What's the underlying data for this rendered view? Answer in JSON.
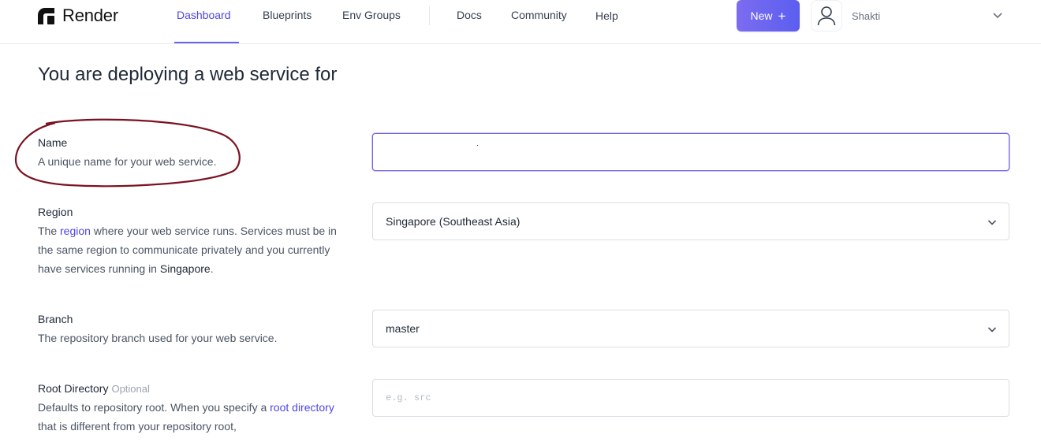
{
  "brand": {
    "name": "Render"
  },
  "nav": {
    "items": [
      {
        "label": "Dashboard",
        "active": true
      },
      {
        "label": "Blueprints"
      },
      {
        "label": "Env Groups"
      },
      {
        "label": "Docs"
      },
      {
        "label": "Community"
      },
      {
        "label": "Help"
      }
    ]
  },
  "header": {
    "new_button": {
      "label": "New",
      "icon": "plus-icon"
    },
    "user": {
      "name": "Shakti",
      "icon": "user-icon"
    }
  },
  "page": {
    "title": "You are deploying a web service for"
  },
  "form": {
    "name": {
      "label": "Name",
      "description": "A unique name for your web service.",
      "value": ""
    },
    "region": {
      "label": "Region",
      "desc_before": "The ",
      "desc_link": "region",
      "desc_after": " where your web service runs. Services must be in the same region to communicate privately and you currently have services running in ",
      "desc_strong": "Singapore",
      "desc_end": ".",
      "value": "Singapore (Southeast Asia)"
    },
    "branch": {
      "label": "Branch",
      "description": "The repository branch used for your web service.",
      "value": "master"
    },
    "root_directory": {
      "label": "Root Directory",
      "optional": "Optional",
      "desc_before": "Defaults to repository root. When you specify a ",
      "desc_link": "root directory",
      "desc_after": " that is different from your repository root,",
      "placeholder": "e.g. src"
    }
  },
  "colors": {
    "accent": "#4f46e5",
    "new_button_start": "#7c6cf0",
    "new_button_end": "#5b5ef0",
    "annotation": "#7a1220"
  }
}
